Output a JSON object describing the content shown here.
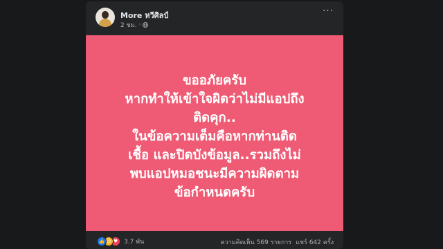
{
  "post": {
    "author": "More หวีศิลป์",
    "time": "2 ชม.",
    "separator": "·",
    "privacy_icon": "globe-icon",
    "more_icon": "more-options-icon",
    "image_text_lines": [
      "ขออภัยครับ",
      "หากทำให้เข้าใจผิดว่าไม่มีแอปถึง",
      "ติดคุก..",
      "ในข้อความเต็มคือหากท่านติด",
      "เชื้อ และปิดบังข้อมูล..รวมถึงไม่",
      "พบแอปหมอชนะมีความผิดตาม",
      "ข้อกำหนดครับ"
    ],
    "image_background": "#ef5a74",
    "reaction_icons": [
      "like-icon",
      "care-icon",
      "love-icon"
    ],
    "reaction_count": "3.7 พัน",
    "comments": "ความคิดเห็น 569 รายการ",
    "shares": "แชร์ 642 ครั้ง"
  },
  "colors": {
    "page_background": "#18191a",
    "card_background": "#242526",
    "primary_text": "#e4e6eb",
    "secondary_text": "#b0b3b8",
    "like": "#1877f2",
    "love": "#f33e58",
    "care": "#f7b125"
  }
}
